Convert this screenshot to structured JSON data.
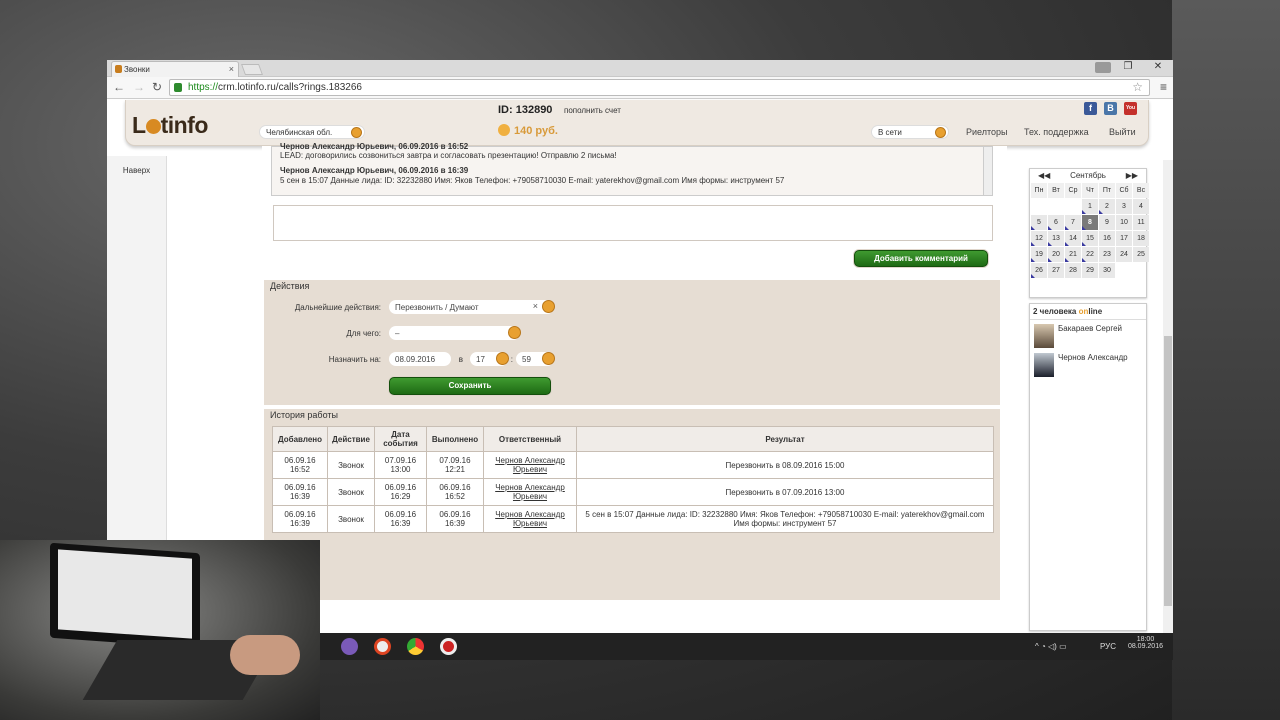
{
  "browser": {
    "tab_title": "Звонки",
    "tab_close": "×",
    "url_https": "https://",
    "url_rest": "crm.lotinfo.ru/calls?rings.183266",
    "min": "–",
    "max": "❐",
    "close": "✕"
  },
  "header": {
    "logo_a": "L",
    "logo_b": "tinfo",
    "id_text": "ID: 132890",
    "topup": "пополнить счет",
    "region": "Челябинская обл.",
    "balance": "140 руб.",
    "status": "В сети",
    "links": [
      "Риелторы",
      "Тех. поддержка",
      "Выйти"
    ],
    "social": [
      "f",
      "B",
      "You"
    ]
  },
  "sidebar": {
    "top_link": "Наверх"
  },
  "comments": {
    "line0": "Чернов Александр Юрьевич, 06.09.2016 в 16:52",
    "line1": "LEAD: договорились созвониться завтра и согласовать презентацию! Отправлю 2 письма!",
    "head2": "Чернов Александр Юрьевич, 06.09.2016 в 16:39",
    "line2": "5 сен в 15:07 Данные лида: ID: 32232880 Имя: Яков Телефон: +79058710030 E-mail: yaterekhov@gmail.com Имя формы: инструмент 57",
    "add_button": "Добавить комментарий"
  },
  "actions": {
    "title": "Действия",
    "next_label": "Дальнейшие действия:",
    "next_value": "Перезвонить / Думают",
    "for_label": "Для чего:",
    "for_value": "–",
    "assign_label": "Назначить на:",
    "date": "08.09.2016",
    "at": "в",
    "hour": "17",
    "colon": ":",
    "minute": "59",
    "save": "Сохранить"
  },
  "history": {
    "title": "История работы",
    "columns": [
      "Добавлено",
      "Действие",
      "Дата события",
      "Выполнено",
      "Ответственный",
      "Результат"
    ],
    "rows": [
      [
        "06.09.16 16:52",
        "Звонок",
        "07.09.16 13:00",
        "07.09.16 12:21",
        "Чернов Александр Юрьевич",
        "Перезвонить в 08.09.2016 15:00"
      ],
      [
        "06.09.16 16:39",
        "Звонок",
        "06.09.16 16:29",
        "06.09.16 16:52",
        "Чернов Александр Юрьевич",
        "Перезвонить в 07.09.2016 13:00"
      ],
      [
        "06.09.16 16:39",
        "Звонок",
        "06.09.16 16:39",
        "06.09.16 16:39",
        "Чернов Александр Юрьевич",
        "5 сен в 15:07 Данные лида: ID: 32232880 Имя: Яков Телефон: +79058710030 E-mail: yaterekhov@gmail.com Имя формы: инструмент 57"
      ]
    ]
  },
  "calendar": {
    "month": "Сентябрь",
    "prev": "◀◀",
    "next": "▶▶",
    "weekdays": [
      "Пн",
      "Вт",
      "Ср",
      "Чт",
      "Пт",
      "Сб",
      "Вс"
    ],
    "days": [
      "",
      "",
      "",
      "1",
      "2",
      "3",
      "4",
      "5",
      "6",
      "7",
      "8",
      "9",
      "10",
      "11",
      "12",
      "13",
      "14",
      "15",
      "16",
      "17",
      "18",
      "19",
      "20",
      "21",
      "22",
      "23",
      "24",
      "25",
      "26",
      "27",
      "28",
      "29",
      "30",
      "",
      ""
    ],
    "today": "8"
  },
  "online": {
    "count_text": "2 человека ",
    "on": "on",
    "line": "line",
    "users": [
      "Бакараев Сергей",
      "Чернов Александр"
    ]
  },
  "taskbar": {
    "lang": "РУС",
    "time": "18:00",
    "date": "08.09.2016"
  }
}
